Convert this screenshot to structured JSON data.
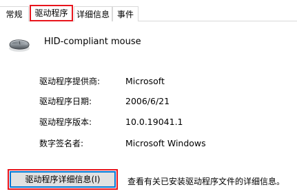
{
  "tabs": [
    {
      "label": "常规"
    },
    {
      "label": "驱动程序"
    },
    {
      "label": "详细信息"
    },
    {
      "label": "事件"
    }
  ],
  "device": {
    "icon": "mouse-icon",
    "name": "HID-compliant mouse"
  },
  "properties": [
    {
      "label": "驱动程序提供商:",
      "value": "Microsoft"
    },
    {
      "label": "驱动程序日期:",
      "value": "2006/6/21"
    },
    {
      "label": "驱动程序版本:",
      "value": "10.0.19041.1"
    },
    {
      "label": "数字签名者:",
      "value": "Microsoft Windows"
    }
  ],
  "actions": {
    "driver_details_button": "驱动程序详细信息(I)",
    "driver_details_description": "查看有关已安装驱动程序文件的详细信息。"
  },
  "colors": {
    "highlight": "#e8141c",
    "focus_border": "#0078d7",
    "button_face": "#e1e1e1",
    "tab_border": "#d9d9d9"
  }
}
